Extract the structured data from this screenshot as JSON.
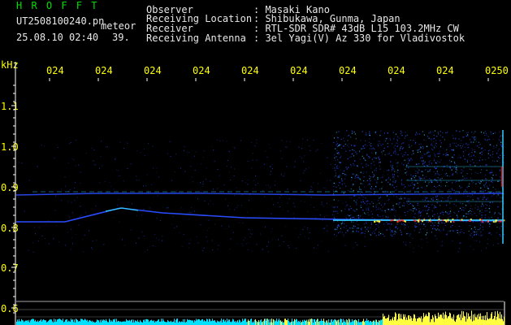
{
  "header": {
    "app_name": "H R O F F T",
    "filename": "UT2508100240.pn",
    "meteor_label": "meteor",
    "datetime": "25.08.10 02:40",
    "count": "39.",
    "info_labels": [
      "Observer",
      "Receiving Location",
      "Receiver",
      "Receiving Antenna"
    ],
    "info_values": [
      ": Masaki Kano",
      ": Shibukawa, Gunma, Japan",
      ": RTL-SDR SDR# 43dB L15 103.2MHz CW",
      ": 3el Yagi(V) Az 330 for Vladivostok"
    ]
  },
  "time_axis": {
    "ticks": [
      "024",
      "024",
      "024",
      "024",
      "024",
      "024",
      "024",
      "024",
      "024",
      "0250"
    ]
  },
  "freq_axis": {
    "unit": "kHz",
    "ticks": [
      "1.1",
      "1.0",
      "0.9",
      "0.8",
      "0.7",
      "0.6"
    ]
  },
  "colors": {
    "header_text": "#00e000",
    "tick_text": "#ffff00",
    "axis_line": "#ffffff",
    "trace_blue": "#2a4cff",
    "trace_cyan": "#33ccff",
    "noise_cyan": "#00e0ff",
    "noise_yellow": "#ffff40",
    "hot_red": "#ff2020"
  }
}
